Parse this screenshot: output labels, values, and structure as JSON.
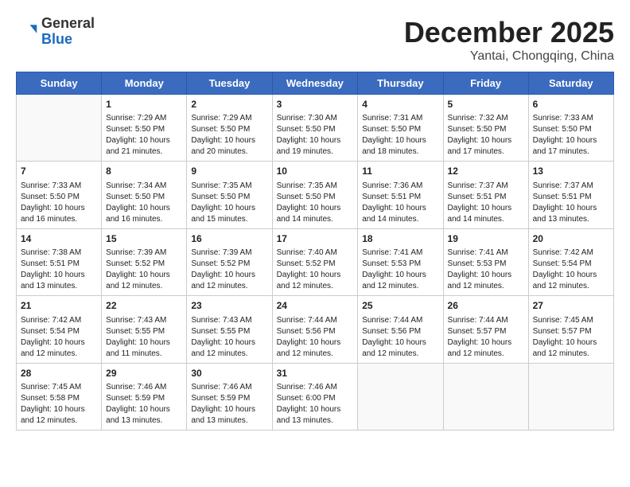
{
  "logo": {
    "general": "General",
    "blue": "Blue"
  },
  "header": {
    "month": "December 2025",
    "location": "Yantai, Chongqing, China"
  },
  "weekdays": [
    "Sunday",
    "Monday",
    "Tuesday",
    "Wednesday",
    "Thursday",
    "Friday",
    "Saturday"
  ],
  "weeks": [
    [
      {
        "day": "",
        "empty": true
      },
      {
        "day": "1",
        "sunrise": "7:29 AM",
        "sunset": "5:50 PM",
        "daylight": "10 hours and 21 minutes."
      },
      {
        "day": "2",
        "sunrise": "7:29 AM",
        "sunset": "5:50 PM",
        "daylight": "10 hours and 20 minutes."
      },
      {
        "day": "3",
        "sunrise": "7:30 AM",
        "sunset": "5:50 PM",
        "daylight": "10 hours and 19 minutes."
      },
      {
        "day": "4",
        "sunrise": "7:31 AM",
        "sunset": "5:50 PM",
        "daylight": "10 hours and 18 minutes."
      },
      {
        "day": "5",
        "sunrise": "7:32 AM",
        "sunset": "5:50 PM",
        "daylight": "10 hours and 17 minutes."
      },
      {
        "day": "6",
        "sunrise": "7:33 AM",
        "sunset": "5:50 PM",
        "daylight": "10 hours and 17 minutes."
      }
    ],
    [
      {
        "day": "7",
        "sunrise": "7:33 AM",
        "sunset": "5:50 PM",
        "daylight": "10 hours and 16 minutes."
      },
      {
        "day": "8",
        "sunrise": "7:34 AM",
        "sunset": "5:50 PM",
        "daylight": "10 hours and 16 minutes."
      },
      {
        "day": "9",
        "sunrise": "7:35 AM",
        "sunset": "5:50 PM",
        "daylight": "10 hours and 15 minutes."
      },
      {
        "day": "10",
        "sunrise": "7:35 AM",
        "sunset": "5:50 PM",
        "daylight": "10 hours and 14 minutes."
      },
      {
        "day": "11",
        "sunrise": "7:36 AM",
        "sunset": "5:51 PM",
        "daylight": "10 hours and 14 minutes."
      },
      {
        "day": "12",
        "sunrise": "7:37 AM",
        "sunset": "5:51 PM",
        "daylight": "10 hours and 14 minutes."
      },
      {
        "day": "13",
        "sunrise": "7:37 AM",
        "sunset": "5:51 PM",
        "daylight": "10 hours and 13 minutes."
      }
    ],
    [
      {
        "day": "14",
        "sunrise": "7:38 AM",
        "sunset": "5:51 PM",
        "daylight": "10 hours and 13 minutes."
      },
      {
        "day": "15",
        "sunrise": "7:39 AM",
        "sunset": "5:52 PM",
        "daylight": "10 hours and 12 minutes."
      },
      {
        "day": "16",
        "sunrise": "7:39 AM",
        "sunset": "5:52 PM",
        "daylight": "10 hours and 12 minutes."
      },
      {
        "day": "17",
        "sunrise": "7:40 AM",
        "sunset": "5:52 PM",
        "daylight": "10 hours and 12 minutes."
      },
      {
        "day": "18",
        "sunrise": "7:41 AM",
        "sunset": "5:53 PM",
        "daylight": "10 hours and 12 minutes."
      },
      {
        "day": "19",
        "sunrise": "7:41 AM",
        "sunset": "5:53 PM",
        "daylight": "10 hours and 12 minutes."
      },
      {
        "day": "20",
        "sunrise": "7:42 AM",
        "sunset": "5:54 PM",
        "daylight": "10 hours and 12 minutes."
      }
    ],
    [
      {
        "day": "21",
        "sunrise": "7:42 AM",
        "sunset": "5:54 PM",
        "daylight": "10 hours and 12 minutes."
      },
      {
        "day": "22",
        "sunrise": "7:43 AM",
        "sunset": "5:55 PM",
        "daylight": "10 hours and 11 minutes."
      },
      {
        "day": "23",
        "sunrise": "7:43 AM",
        "sunset": "5:55 PM",
        "daylight": "10 hours and 12 minutes."
      },
      {
        "day": "24",
        "sunrise": "7:44 AM",
        "sunset": "5:56 PM",
        "daylight": "10 hours and 12 minutes."
      },
      {
        "day": "25",
        "sunrise": "7:44 AM",
        "sunset": "5:56 PM",
        "daylight": "10 hours and 12 minutes."
      },
      {
        "day": "26",
        "sunrise": "7:44 AM",
        "sunset": "5:57 PM",
        "daylight": "10 hours and 12 minutes."
      },
      {
        "day": "27",
        "sunrise": "7:45 AM",
        "sunset": "5:57 PM",
        "daylight": "10 hours and 12 minutes."
      }
    ],
    [
      {
        "day": "28",
        "sunrise": "7:45 AM",
        "sunset": "5:58 PM",
        "daylight": "10 hours and 12 minutes."
      },
      {
        "day": "29",
        "sunrise": "7:46 AM",
        "sunset": "5:59 PM",
        "daylight": "10 hours and 13 minutes."
      },
      {
        "day": "30",
        "sunrise": "7:46 AM",
        "sunset": "5:59 PM",
        "daylight": "10 hours and 13 minutes."
      },
      {
        "day": "31",
        "sunrise": "7:46 AM",
        "sunset": "6:00 PM",
        "daylight": "10 hours and 13 minutes."
      },
      {
        "day": "",
        "empty": true
      },
      {
        "day": "",
        "empty": true
      },
      {
        "day": "",
        "empty": true
      }
    ]
  ]
}
